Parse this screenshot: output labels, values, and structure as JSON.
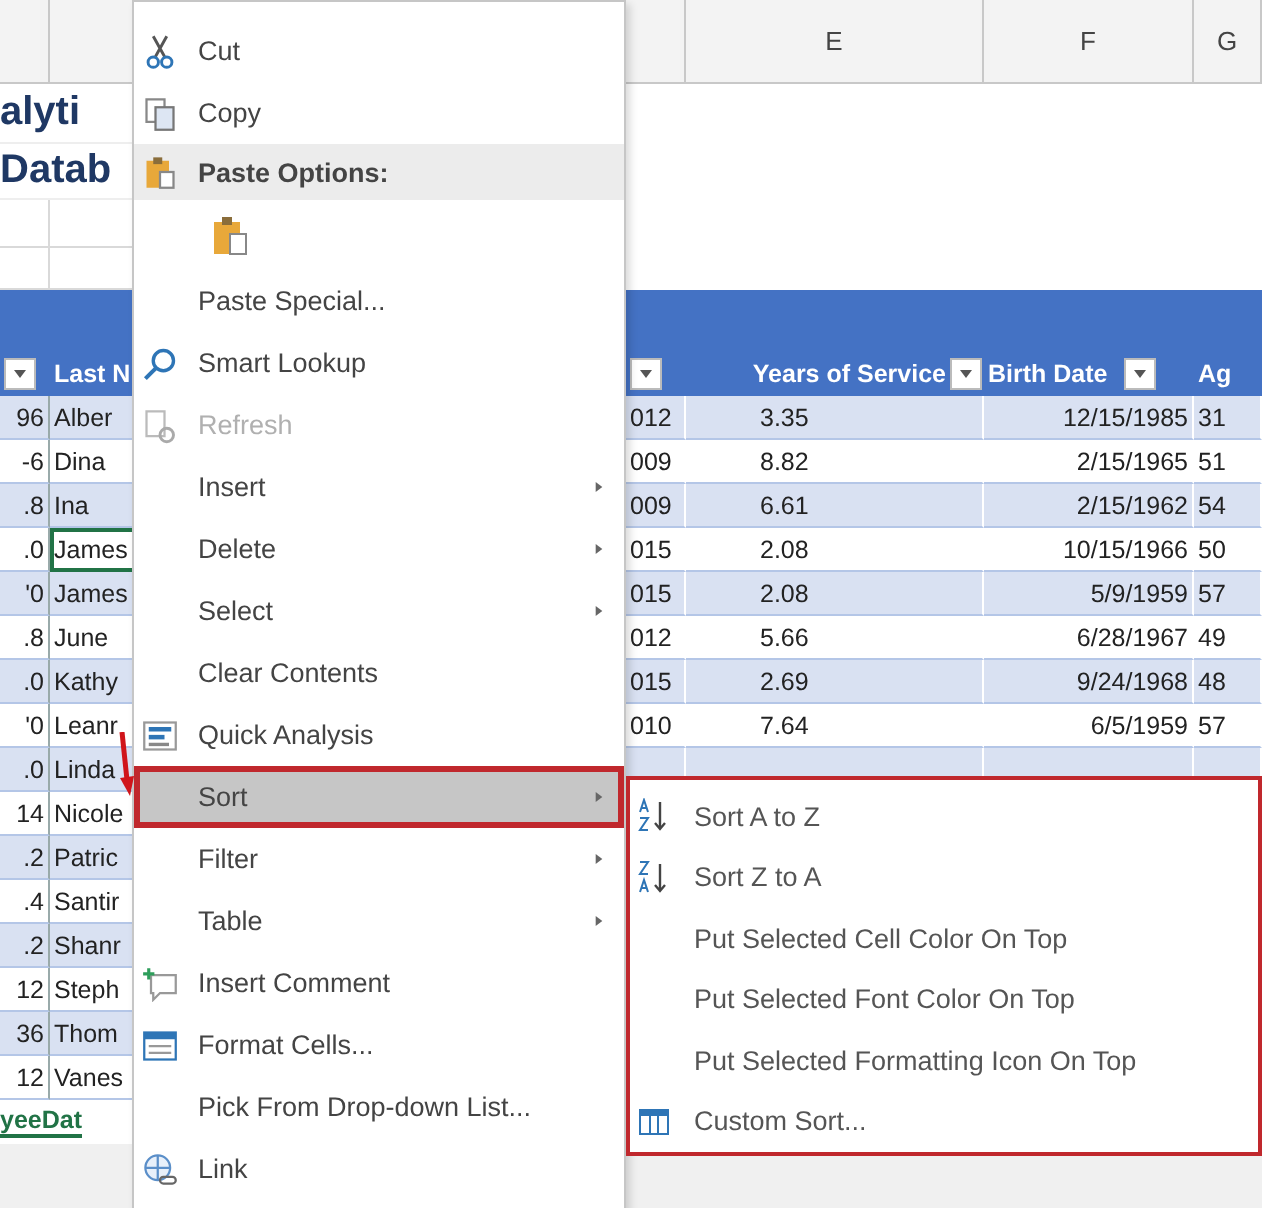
{
  "sheet": {
    "column_headers": [
      "E",
      "F",
      "G"
    ],
    "title_lines": [
      "alyti",
      "Datab"
    ],
    "table_headers": {
      "last_name": "Last N",
      "years_of_service": "Years of Service",
      "birth_date": "Birth Date",
      "age": "Ag"
    },
    "rows": [
      {
        "column_1": "96",
        "last_name": "Alber",
        "column_4": "012",
        "years_of_service": "3.35",
        "birth_date": "12/15/1985",
        "age": "31",
        "selected": false
      },
      {
        "column_1": "-6",
        "last_name": "Dina",
        "column_4": "009",
        "years_of_service": "8.82",
        "birth_date": "2/15/1965",
        "age": "51",
        "selected": false
      },
      {
        "column_1": ".8",
        "last_name": "Ina",
        "column_4": "009",
        "years_of_service": "6.61",
        "birth_date": "2/15/1962",
        "age": "54",
        "selected": false
      },
      {
        "column_1": ".0",
        "last_name": "James",
        "column_4": "015",
        "years_of_service": "2.08",
        "birth_date": "10/15/1966",
        "age": "50",
        "selected": true
      },
      {
        "column_1": "'0",
        "last_name": "James",
        "column_4": "015",
        "years_of_service": "2.08",
        "birth_date": "5/9/1959",
        "age": "57",
        "selected": false
      },
      {
        "column_1": ".8",
        "last_name": "June",
        "column_4": "012",
        "years_of_service": "5.66",
        "birth_date": "6/28/1967",
        "age": "49",
        "selected": false
      },
      {
        "column_1": ".0",
        "last_name": "Kathy",
        "column_4": "015",
        "years_of_service": "2.69",
        "birth_date": "9/24/1968",
        "age": "48",
        "selected": false
      },
      {
        "column_1": "'0",
        "last_name": "Leanr",
        "column_4": "010",
        "years_of_service": "7.64",
        "birth_date": "6/5/1959",
        "age": "57",
        "selected": false
      },
      {
        "column_1": ".0",
        "last_name": "Linda",
        "selected": false
      },
      {
        "column_1": "14",
        "last_name": "Nicole",
        "selected": false
      },
      {
        "column_1": ".2",
        "last_name": "Patric",
        "selected": false
      },
      {
        "column_1": ".4",
        "last_name": "Santir",
        "selected": false
      },
      {
        "column_1": ".2",
        "last_name": "Shanr",
        "selected": false
      },
      {
        "column_1": "12",
        "last_name": "Steph",
        "selected": false
      },
      {
        "column_1": "36",
        "last_name": "Thom",
        "selected": false
      },
      {
        "column_1": "12",
        "last_name": "Vanes",
        "selected": false
      }
    ],
    "sheet_tab": "yeeDat"
  },
  "context_menu": {
    "items": [
      {
        "kind": "item",
        "label": "Cut",
        "disabled": false,
        "submenu": false,
        "selected": false
      },
      {
        "kind": "item",
        "label": "Copy",
        "disabled": false,
        "submenu": false,
        "selected": false
      },
      {
        "kind": "header",
        "label": "Paste Options:"
      },
      {
        "kind": "paste-option"
      },
      {
        "kind": "item",
        "label": "Paste Special...",
        "disabled": false,
        "submenu": false,
        "selected": false
      },
      {
        "kind": "item",
        "label": "Smart Lookup",
        "disabled": false,
        "submenu": false,
        "selected": false
      },
      {
        "kind": "item",
        "label": "Refresh",
        "disabled": true,
        "submenu": false,
        "selected": false
      },
      {
        "kind": "item",
        "label": "Insert",
        "disabled": false,
        "submenu": true,
        "selected": false
      },
      {
        "kind": "item",
        "label": "Delete",
        "disabled": false,
        "submenu": true,
        "selected": false
      },
      {
        "kind": "item",
        "label": "Select",
        "disabled": false,
        "submenu": true,
        "selected": false
      },
      {
        "kind": "item",
        "label": "Clear Contents",
        "disabled": false,
        "submenu": false,
        "selected": false
      },
      {
        "kind": "item",
        "label": "Quick Analysis",
        "disabled": false,
        "submenu": false,
        "selected": false
      },
      {
        "kind": "item",
        "label": "Sort",
        "disabled": false,
        "submenu": true,
        "selected": true
      },
      {
        "kind": "item",
        "label": "Filter",
        "disabled": false,
        "submenu": true,
        "selected": false
      },
      {
        "kind": "item",
        "label": "Table",
        "disabled": false,
        "submenu": true,
        "selected": false
      },
      {
        "kind": "item",
        "label": "Insert Comment",
        "disabled": false,
        "submenu": false,
        "selected": false
      },
      {
        "kind": "item",
        "label": "Format Cells...",
        "disabled": false,
        "submenu": false,
        "selected": false
      },
      {
        "kind": "item",
        "label": "Pick From Drop-down List...",
        "disabled": false,
        "submenu": false,
        "selected": false
      },
      {
        "kind": "item",
        "label": "Link",
        "disabled": false,
        "submenu": false,
        "selected": false
      }
    ]
  },
  "sort_submenu": {
    "items": [
      {
        "label": "Sort A to Z"
      },
      {
        "label": "Sort Z to A"
      },
      {
        "label": "Put Selected Cell Color On Top"
      },
      {
        "label": "Put Selected Font Color On Top"
      },
      {
        "label": "Put Selected Formatting Icon On Top"
      },
      {
        "label": "Custom Sort..."
      }
    ]
  }
}
